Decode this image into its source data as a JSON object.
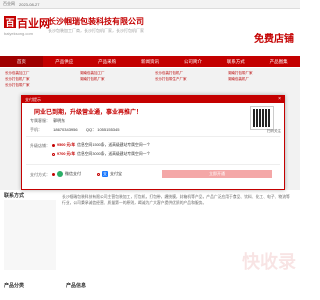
{
  "topbar": {
    "site_name": "百业网",
    "date": "2023-08-27"
  },
  "header": {
    "logo_mark": "百",
    "logo_text": "百业网",
    "logo_sub": "baiyeksong.com",
    "company_title": "长沙帼瑞包装科技有限公司",
    "company_desc": "长沙包装加工厂商，长沙打包机厂家，长沙打包机厂家",
    "free_shop": "免费店铺"
  },
  "nav": [
    "首页",
    "产品供应",
    "产品采购",
    "新闻资讯",
    "公司简介",
    "联系方式",
    "产品图集"
  ],
  "background_cols": [
    [
      "长沙包装加工厂",
      "长沙打包机厂家",
      "长沙打包带厂家"
    ],
    [
      "湖南包装加工厂",
      "湖南打包机厂家"
    ],
    [
      "长沙包装打包机厂",
      "长沙打包带生产厂家"
    ],
    [
      "湖南打包带厂家",
      "湖南包装机厂"
    ]
  ],
  "modal": {
    "header_title": "支付提示",
    "close": "×",
    "banner": "同业已到期，升级营业通，事业再推广！",
    "qr_label": "扫码关注",
    "shop_name_label": "专属客服：",
    "shop_name": "郭明东",
    "phone_label": "手机：",
    "phone": "18670343956",
    "qq_label": "QQ：",
    "qq": "1055155345",
    "service_label": "升级店铺：",
    "options": [
      {
        "price": "¥500 元/年",
        "desc": "信息空间1500条，送高级建站专属空间一个"
      },
      {
        "price": "¥700 元/年",
        "desc": "信息空间3000条，送高级建站专属空间一个"
      }
    ],
    "pay_label": "支付方式：",
    "wechat": "微信支付",
    "alipay": "支付宝",
    "pay_button": "立即开通"
  },
  "content": {
    "sidebar_title": "联系方式",
    "main_text": "长沙帼瑞包装科技有限公司主营包装加工，打包机，打包带，缠绕膜，封箱机等产品，产品广泛应用于食品、饮料、化工、电子、物流等行业，公司秉承诚信经营、质量第一的原则，竭诚为广大客户提供优质的产品和服务。",
    "bottom_left": "产品分类",
    "bottom_right": "产品信息"
  },
  "watermark": "快收录"
}
